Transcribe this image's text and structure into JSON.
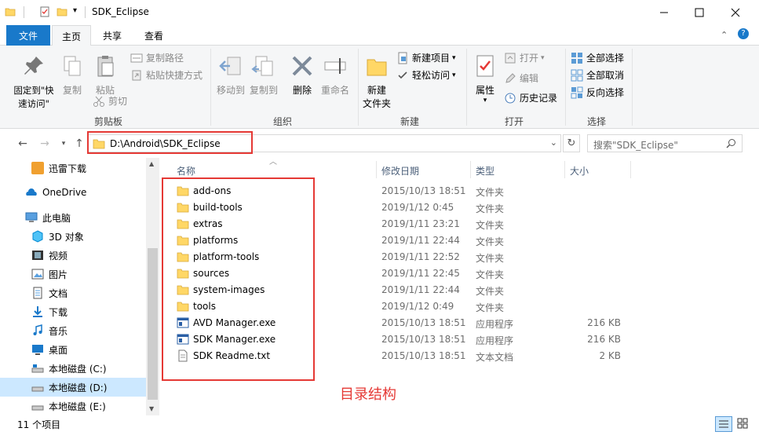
{
  "window": {
    "title": "SDK_Eclipse",
    "minimize_icon": "minimize-icon",
    "maximize_icon": "maximize-icon",
    "close_icon": "close-icon"
  },
  "ribbon_tabs": {
    "file": "文件",
    "home": "主页",
    "share": "共享",
    "view": "查看"
  },
  "ribbon": {
    "clipboard": {
      "pin_label": "固定到\"快\n速访问\"",
      "copy_label": "复制",
      "paste_label": "粘贴",
      "copy_path": "复制路径",
      "paste_shortcut": "粘贴快捷方式",
      "cut": "剪切",
      "group_label": "剪贴板"
    },
    "organize": {
      "move_to": "移动到",
      "copy_to": "复制到",
      "delete": "删除",
      "rename": "重命名",
      "group_label": "组织"
    },
    "new": {
      "new_folder": "新建\n文件夹",
      "new_item": "新建项目",
      "easy_access": "轻松访问",
      "group_label": "新建"
    },
    "open": {
      "properties": "属性",
      "open": "打开",
      "edit": "编辑",
      "history": "历史记录",
      "group_label": "打开"
    },
    "select": {
      "select_all": "全部选择",
      "select_none": "全部取消",
      "invert": "反向选择",
      "group_label": "选择"
    }
  },
  "address": {
    "path": "D:\\Android\\SDK_Eclipse",
    "search_placeholder": "搜索\"SDK_Eclipse\""
  },
  "sidebar": {
    "items": [
      {
        "label": "迅雷下载",
        "icon": "thunder-download-icon"
      },
      {
        "label": "OneDrive",
        "icon": "onedrive-icon"
      },
      {
        "label": "此电脑",
        "icon": "this-pc-icon"
      },
      {
        "label": "3D 对象",
        "icon": "3d-objects-icon"
      },
      {
        "label": "视频",
        "icon": "videos-icon"
      },
      {
        "label": "图片",
        "icon": "pictures-icon"
      },
      {
        "label": "文档",
        "icon": "documents-icon"
      },
      {
        "label": "下载",
        "icon": "downloads-icon"
      },
      {
        "label": "音乐",
        "icon": "music-icon"
      },
      {
        "label": "桌面",
        "icon": "desktop-icon"
      },
      {
        "label": "本地磁盘 (C:)",
        "icon": "drive-icon"
      },
      {
        "label": "本地磁盘 (D:)",
        "icon": "drive-icon"
      },
      {
        "label": "本地磁盘 (E:)",
        "icon": "drive-icon"
      }
    ]
  },
  "columns": {
    "name": "名称",
    "date": "修改日期",
    "type": "类型",
    "size": "大小"
  },
  "files": [
    {
      "name": "add-ons",
      "date": "2015/10/13 18:51",
      "type": "文件夹",
      "size": "",
      "kind": "folder"
    },
    {
      "name": "build-tools",
      "date": "2019/1/12 0:45",
      "type": "文件夹",
      "size": "",
      "kind": "folder"
    },
    {
      "name": "extras",
      "date": "2019/1/11 23:21",
      "type": "文件夹",
      "size": "",
      "kind": "folder"
    },
    {
      "name": "platforms",
      "date": "2019/1/11 22:44",
      "type": "文件夹",
      "size": "",
      "kind": "folder"
    },
    {
      "name": "platform-tools",
      "date": "2019/1/11 22:52",
      "type": "文件夹",
      "size": "",
      "kind": "folder"
    },
    {
      "name": "sources",
      "date": "2019/1/11 22:45",
      "type": "文件夹",
      "size": "",
      "kind": "folder"
    },
    {
      "name": "system-images",
      "date": "2019/1/11 22:44",
      "type": "文件夹",
      "size": "",
      "kind": "folder"
    },
    {
      "name": "tools",
      "date": "2019/1/12 0:49",
      "type": "文件夹",
      "size": "",
      "kind": "folder"
    },
    {
      "name": "AVD Manager.exe",
      "date": "2015/10/13 18:51",
      "type": "应用程序",
      "size": "216 KB",
      "kind": "exe"
    },
    {
      "name": "SDK Manager.exe",
      "date": "2015/10/13 18:51",
      "type": "应用程序",
      "size": "216 KB",
      "kind": "exe"
    },
    {
      "name": "SDK Readme.txt",
      "date": "2015/10/13 18:51",
      "type": "文本文档",
      "size": "2 KB",
      "kind": "txt"
    }
  ],
  "annotation": "目录结构",
  "status": {
    "item_count": "11 个项目"
  },
  "colors": {
    "accent": "#1979ca",
    "folder": "#ffd766",
    "annotation_red": "#e53935",
    "selected": "#cce8ff"
  }
}
